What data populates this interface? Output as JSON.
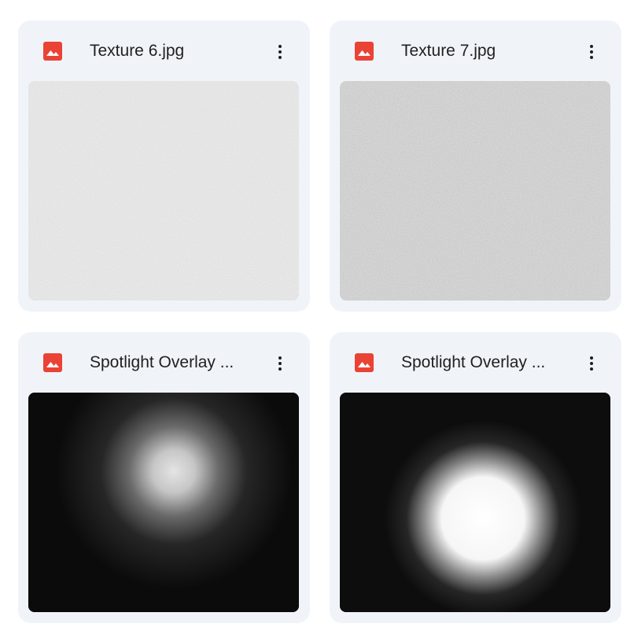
{
  "files": [
    {
      "name": "Texture 6.jpg",
      "type_icon": "image-file-icon",
      "menu_icon": "more-vert-icon",
      "thumbnail": "white-paper-texture"
    },
    {
      "name": "Texture 7.jpg",
      "type_icon": "image-file-icon",
      "menu_icon": "more-vert-icon",
      "thumbnail": "grey-paper-texture"
    },
    {
      "name": "Spotlight Overlay ...",
      "type_icon": "image-file-icon",
      "menu_icon": "more-vert-icon",
      "thumbnail": "soft-spotlight-on-black"
    },
    {
      "name": "Spotlight Overlay ...",
      "type_icon": "image-file-icon",
      "menu_icon": "more-vert-icon",
      "thumbnail": "bright-spotlight-on-black"
    }
  ],
  "colors": {
    "card_background": "#f0f4f9",
    "file_icon": "#ea4335",
    "text": "#1f1f1f"
  }
}
